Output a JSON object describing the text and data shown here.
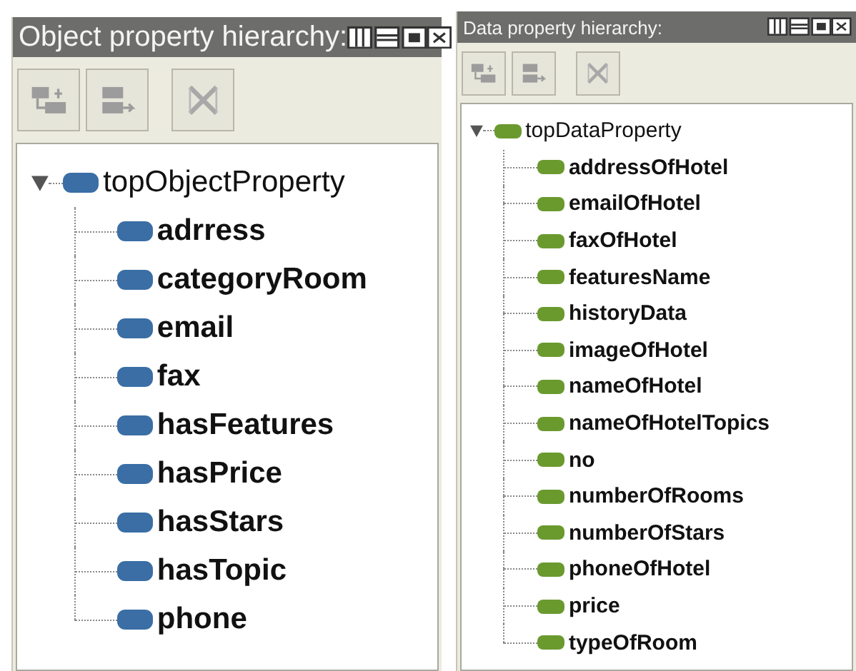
{
  "panels": [
    {
      "title": "Object property hierarchy:",
      "color": "#3a6ea5",
      "tree": {
        "label": "topObjectProperty",
        "expanded": true,
        "children": [
          {
            "label": "adrress"
          },
          {
            "label": "categoryRoom"
          },
          {
            "label": "email"
          },
          {
            "label": "fax"
          },
          {
            "label": "hasFeatures"
          },
          {
            "label": "hasPrice"
          },
          {
            "label": "hasStars"
          },
          {
            "label": "hasTopic"
          },
          {
            "label": "phone"
          }
        ]
      }
    },
    {
      "title": "Data property hierarchy:",
      "color": "#6a9a2e",
      "tree": {
        "label": "topDataProperty",
        "expanded": true,
        "children": [
          {
            "label": "addressOfHotel"
          },
          {
            "label": "emailOfHotel"
          },
          {
            "label": "faxOfHotel"
          },
          {
            "label": "featuresName"
          },
          {
            "label": "historyData"
          },
          {
            "label": "imageOfHotel"
          },
          {
            "label": "nameOfHotel"
          },
          {
            "label": "nameOfHotelTopics"
          },
          {
            "label": "no"
          },
          {
            "label": "numberOfRooms"
          },
          {
            "label": "numberOfStars"
          },
          {
            "label": "phoneOfHotel"
          },
          {
            "label": "price"
          },
          {
            "label": "typeOfRoom"
          }
        ]
      }
    }
  ]
}
